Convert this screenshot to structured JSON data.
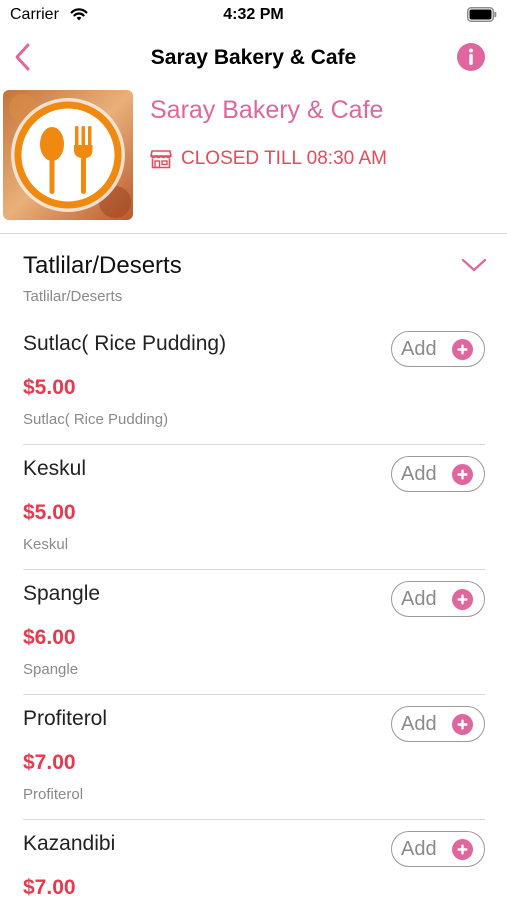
{
  "status_bar": {
    "carrier": "Carrier",
    "time": "4:32 PM"
  },
  "nav": {
    "title": "Saray Bakery & Cafe"
  },
  "restaurant": {
    "name": "Saray Bakery & Cafe",
    "status": "CLOSED TILL 08:30 AM"
  },
  "category": {
    "title": "Tatlilar/Deserts",
    "subtitle": "Tatlilar/Deserts"
  },
  "add_label": "Add",
  "items": [
    {
      "name": "Sutlac( Rice Pudding)",
      "price": "$5.00",
      "description": "Sutlac( Rice Pudding)"
    },
    {
      "name": "Keskul",
      "price": "$5.00",
      "description": "Keskul"
    },
    {
      "name": "Spangle",
      "price": "$6.00",
      "description": "Spangle"
    },
    {
      "name": "Profiterol",
      "price": "$7.00",
      "description": "Profiterol"
    },
    {
      "name": "Kazandibi",
      "price": "$7.00",
      "description": ""
    }
  ],
  "colors": {
    "accent_pink": "#e0669e",
    "price_red": "#e8394d",
    "status_red": "#e84a5a",
    "logo_orange": "#f0890f"
  },
  "icons": {
    "back": "chevron-left-icon",
    "info": "info-icon",
    "store": "store-icon",
    "expand": "chevron-down-icon",
    "add": "plus-circle-icon"
  }
}
